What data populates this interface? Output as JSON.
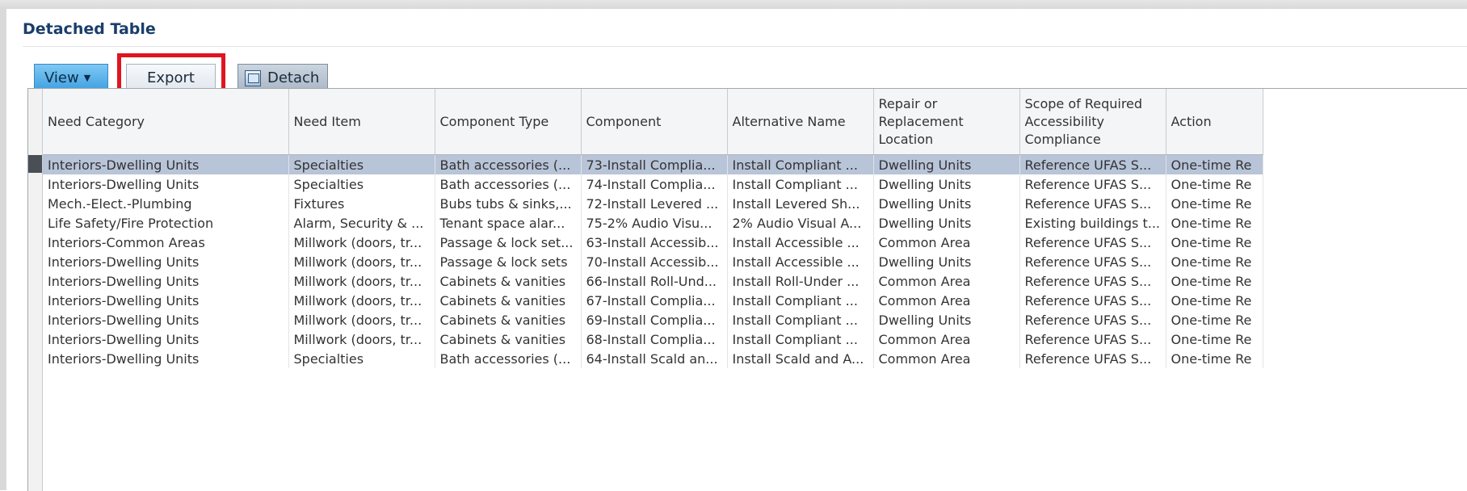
{
  "panel": {
    "title": "Detached Table"
  },
  "toolbar": {
    "view_label": "View",
    "view_caret": "▼",
    "export_label": "Export",
    "detach_label": "Detach"
  },
  "colors": {
    "highlight": "#e0151f",
    "title": "#1a3e6a",
    "view_button": "#3a9ee0",
    "selected_row": "#b8c4d8"
  },
  "table": {
    "columns": [
      "Need Category",
      "Need Item",
      "Component Type",
      "Component",
      "Alternative Name",
      "Repair or Replacement Location",
      "Scope of Required Accessibility Compliance",
      "Action"
    ],
    "selected_row": 0,
    "rows": [
      [
        "Interiors-Dwelling Units",
        "Specialties",
        "Bath accessories (...",
        "73-Install Complia...",
        "Install Compliant ...",
        "Dwelling Units",
        "Reference UFAS S...",
        "One-time Re"
      ],
      [
        "Interiors-Dwelling Units",
        "Specialties",
        "Bath accessories (...",
        "74-Install Complia...",
        "Install Compliant ...",
        "Dwelling Units",
        "Reference UFAS S...",
        "One-time Re"
      ],
      [
        "Mech.-Elect.-Plumbing",
        "Fixtures",
        "Bubs tubs & sinks,...",
        "72-Install Levered ...",
        "Install Levered Sh...",
        "Dwelling Units",
        "Reference UFAS S...",
        "One-time Re"
      ],
      [
        "Life Safety/Fire Protection",
        "Alarm, Security & ...",
        "Tenant space alar...",
        "75-2% Audio Visu...",
        "2% Audio Visual A...",
        "Dwelling Units",
        "Existing buildings t...",
        "One-time Re"
      ],
      [
        "Interiors-Common Areas",
        "Millwork (doors, tr...",
        "Passage & lock set...",
        "63-Install Accessib...",
        "Install Accessible ...",
        "Common Area",
        "Reference UFAS S...",
        "One-time Re"
      ],
      [
        "Interiors-Dwelling Units",
        "Millwork (doors, tr...",
        "Passage & lock sets",
        "70-Install Accessib...",
        "Install Accessible ...",
        "Dwelling Units",
        "Reference UFAS S...",
        "One-time Re"
      ],
      [
        "Interiors-Dwelling Units",
        "Millwork (doors, tr...",
        "Cabinets & vanities",
        "66-Install Roll-Und...",
        "Install Roll-Under ...",
        "Common Area",
        "Reference UFAS S...",
        "One-time Re"
      ],
      [
        "Interiors-Dwelling Units",
        "Millwork (doors, tr...",
        "Cabinets & vanities",
        "67-Install Complia...",
        "Install Compliant ...",
        "Common Area",
        "Reference UFAS S...",
        "One-time Re"
      ],
      [
        "Interiors-Dwelling Units",
        "Millwork (doors, tr...",
        "Cabinets & vanities",
        "69-Install Complia...",
        "Install Compliant ...",
        "Dwelling Units",
        "Reference UFAS S...",
        "One-time Re"
      ],
      [
        "Interiors-Dwelling Units",
        "Millwork (doors, tr...",
        "Cabinets & vanities",
        "68-Install Complia...",
        "Install Compliant ...",
        "Common Area",
        "Reference UFAS S...",
        "One-time Re"
      ],
      [
        "Interiors-Dwelling Units",
        "Specialties",
        "Bath accessories (...",
        "64-Install Scald an...",
        "Install Scald and A...",
        "Common Area",
        "Reference UFAS S...",
        "One-time Re"
      ]
    ]
  }
}
